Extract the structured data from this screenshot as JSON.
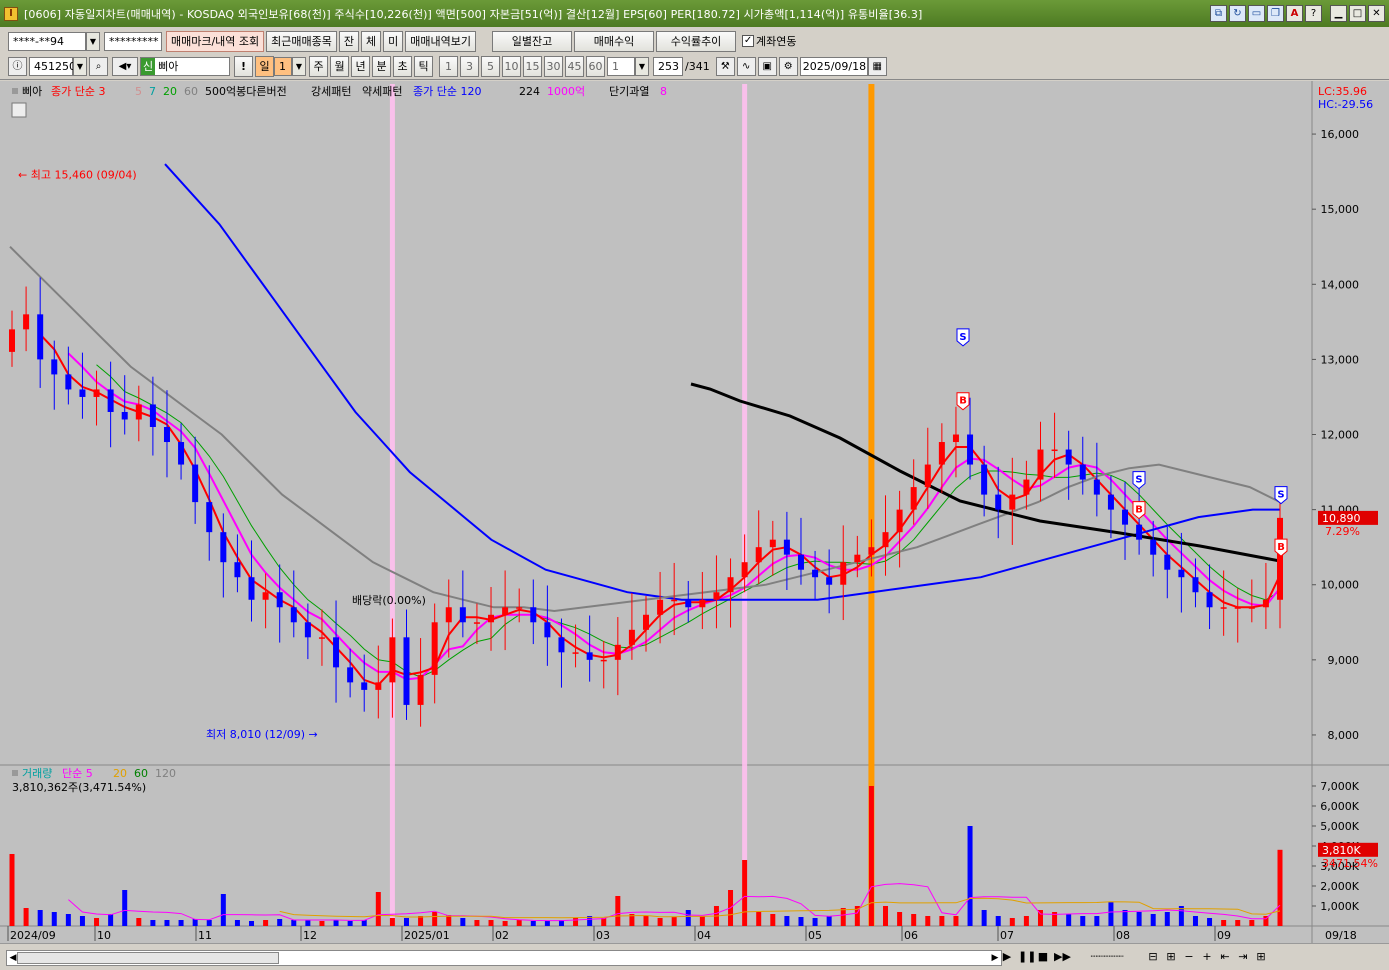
{
  "window": {
    "title": "[0606] 자동일지차트(매매내역) - KOSDAQ 외국인보유[68(천)] 주식수[10,226(천)] 액면[500] 자본금[51(억)] 결산[12월] EPS[60] PER[180.72] 시가총액[1,114(억)] 유통비율[36.3]",
    "app_icon": "I"
  },
  "toolbar1": {
    "account": "****-**94",
    "password": "*********",
    "buttons": [
      "매매마크/내역 조회",
      "최근매매종목",
      "잔",
      "체",
      "미",
      "매매내역보기"
    ],
    "tabs": [
      "일별잔고",
      "매매수익",
      "수익률추이"
    ],
    "link_label": "계좌연동"
  },
  "toolbar2": {
    "code": "451250",
    "name_badge": "신",
    "name": "삐아",
    "period": "일",
    "period_value": "1",
    "periods": [
      "주",
      "월",
      "년",
      "분",
      "초",
      "틱"
    ],
    "minutes": [
      "1",
      "3",
      "5",
      "10",
      "15",
      "30",
      "45",
      "60"
    ],
    "min_value": "1",
    "count_current": "253",
    "count_total": "/341",
    "date": "2025/09/18"
  },
  "colors": {
    "candle_up": "#ff0000",
    "candle_down": "#0000ff",
    "ma3": "#ff0000",
    "ma5": "#d0a0a0",
    "ma7": "#00a0a0",
    "ma20": "#ff00ff",
    "ma60": "#00a000",
    "ma120": "#0000ff",
    "ma224": "#808080",
    "trend": "#000000",
    "highlight_orange": "#ff9900",
    "highlight_pink": "#ffc0f0"
  },
  "price_pane": {
    "legend": [
      {
        "text": "삐아",
        "color": "#000000"
      },
      {
        "text": "종가 단순 3",
        "color": "#ff0000"
      },
      {
        "text": "5",
        "color": "#d09090"
      },
      {
        "text": "7",
        "color": "#00a0a0"
      },
      {
        "text": "20",
        "color": "#00a000"
      },
      {
        "text": "60",
        "color": "#808080"
      },
      {
        "text": "500억봉다른버전",
        "color": "#000000"
      },
      {
        "text": "강세패턴",
        "color": "#000000"
      },
      {
        "text": "약세패턴",
        "color": "#000000"
      },
      {
        "text": "종가 단순 120",
        "color": "#0000ff"
      },
      {
        "text": "224",
        "color": "#000000"
      },
      {
        "text": "1000억",
        "color": "#ff00ff"
      },
      {
        "text": "단기과열",
        "color": "#000000"
      },
      {
        "text": "8",
        "color": "#ff00ff"
      }
    ],
    "lc_label": "LC:35.96",
    "hc_label": "HC:-29.56",
    "y_ticks": [
      "16,000",
      "15,000",
      "14,000",
      "13,000",
      "12,000",
      "11,000",
      "10,000",
      "9,000",
      "8,000"
    ],
    "y_tick_values": [
      16000,
      15000,
      14000,
      13000,
      12000,
      11000,
      10000,
      9000,
      8000
    ],
    "high_label": "최고 15,460 (09/04)",
    "low_label": "최저 8,010 (12/09)",
    "note_label": "배당락(0.00%)",
    "current_price": "10,890",
    "current_pct": "7.29%",
    "marks": [
      {
        "type": "S",
        "color": "#0000ff"
      },
      {
        "type": "B",
        "color": "#ff0000"
      },
      {
        "type": "S",
        "color": "#0000ff"
      },
      {
        "type": "B",
        "color": "#ff0000"
      },
      {
        "type": "S",
        "color": "#0000ff"
      },
      {
        "type": "B",
        "color": "#ff0000"
      }
    ]
  },
  "volume_pane": {
    "legend": [
      {
        "text": "거래량",
        "color": "#00a0a0"
      },
      {
        "text": "단순 5",
        "color": "#ff00ff"
      },
      {
        "text": "20",
        "color": "#e0a000"
      },
      {
        "text": "60",
        "color": "#008000"
      },
      {
        "text": "120",
        "color": "#808080"
      }
    ],
    "current_value": "3,810,362주(3,471.54%)",
    "y_ticks": [
      "7,000K",
      "6,000K",
      "5,000K",
      "4,000K",
      "3,000K",
      "2,000K",
      "1,000K"
    ],
    "y_tick_values": [
      7000,
      6000,
      5000,
      4000,
      3000,
      2000,
      1000
    ],
    "current_badge": "3,810K",
    "current_pct": "3471.54%"
  },
  "x_axis": {
    "labels": [
      "2024/09",
      "10",
      "11",
      "12",
      "2025/01",
      "02",
      "03",
      "04",
      "05",
      "06",
      "07",
      "08",
      "09"
    ],
    "end_label": "09/18"
  },
  "chart_data": {
    "type": "candlestick",
    "ylim": [
      7600,
      16600
    ],
    "volume_ylim": [
      0,
      7400
    ],
    "key_points": [
      {
        "label": "최고",
        "value": 15460,
        "date": "09/04"
      },
      {
        "label": "최저",
        "value": 8010,
        "date": "12/09"
      }
    ],
    "closes": [
      13400,
      13600,
      13000,
      12800,
      12600,
      12500,
      12600,
      12300,
      12200,
      12400,
      12100,
      11900,
      11600,
      11100,
      10700,
      10300,
      10100,
      9800,
      9900,
      9700,
      9500,
      9300,
      9300,
      8900,
      8700,
      8600,
      8700,
      9300,
      8400,
      8800,
      9500,
      9700,
      9500,
      9500,
      9600,
      9700,
      9700,
      9500,
      9300,
      9100,
      9100,
      9000,
      9000,
      9200,
      9400,
      9600,
      9800,
      9800,
      9700,
      9800,
      9900,
      10100,
      10300,
      10500,
      10600,
      10400,
      10200,
      10100,
      10000,
      10300,
      10400,
      10500,
      10700,
      11000,
      11300,
      11600,
      11900,
      12000,
      11600,
      11200,
      11000,
      11200,
      11400,
      11800,
      11800,
      11600,
      11400,
      11200,
      11000,
      10800,
      10600,
      10400,
      10200,
      10100,
      9900,
      9700,
      9700,
      9700,
      9700,
      9800,
      10890
    ],
    "volumes": [
      3600,
      900,
      800,
      700,
      600,
      500,
      400,
      600,
      1800,
      400,
      300,
      300,
      300,
      350,
      300,
      1600,
      300,
      250,
      300,
      350,
      300,
      300,
      250,
      300,
      250,
      300,
      1700,
      400,
      400,
      500,
      700,
      550,
      400,
      300,
      300,
      250,
      300,
      250,
      250,
      300,
      400,
      500,
      400,
      1500,
      600,
      500,
      400,
      450,
      800,
      500,
      1000,
      1800,
      3300,
      700,
      600,
      500,
      450,
      400,
      500,
      900,
      1000,
      7000,
      1000,
      700,
      600,
      500,
      500,
      500,
      5000,
      800,
      500,
      400,
      500,
      800,
      700,
      600,
      500,
      500,
      1200,
      800,
      700,
      600,
      700,
      1000,
      500,
      400,
      300,
      300,
      300,
      500,
      3810
    ],
    "series": [
      {
        "name": "종가 단순 120",
        "values": [
          null,
          null,
          null,
          null,
          null,
          null,
          null,
          null,
          null,
          null,
          15600,
          15200,
          14800,
          14300,
          13800,
          13300,
          12800,
          12300,
          11900,
          11500,
          11200,
          10900,
          10600,
          10400,
          10200,
          10100,
          10000,
          9900,
          9850,
          9800,
          9800,
          9800,
          9800,
          9800,
          9800,
          9850,
          9900,
          9950,
          10000,
          10050,
          10100,
          10200,
          10300,
          10400,
          10500,
          10600,
          10700,
          10800,
          10900,
          10950,
          11000,
          11000
        ]
      },
      {
        "name": "224",
        "values": [
          14500,
          14100,
          13700,
          13300,
          12900,
          12600,
          12300,
          12000,
          11600,
          11200,
          10900,
          10600,
          10300,
          10100,
          9900,
          9800,
          9700,
          9700,
          9650,
          9700,
          9750,
          9800,
          9850,
          9900,
          9950,
          10000,
          10100,
          10200,
          10300,
          10400,
          10500,
          10650,
          10800,
          10950,
          11100,
          11300,
          11450,
          11550,
          11600,
          11500,
          11400,
          11300,
          11100
        ]
      }
    ]
  }
}
